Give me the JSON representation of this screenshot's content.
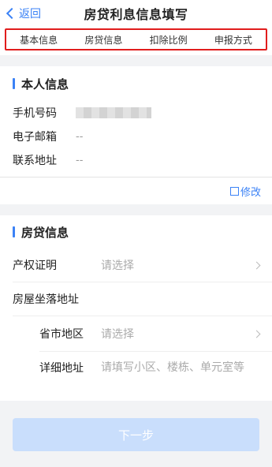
{
  "nav": {
    "back_label": "返回",
    "title": "房贷利息信息填写"
  },
  "tabs": [
    "基本信息",
    "房贷信息",
    "扣除比例",
    "申报方式"
  ],
  "personal": {
    "section_title": "本人信息",
    "phone_label": "手机号码",
    "email_label": "电子邮箱",
    "email_value": "--",
    "address_label": "联系地址",
    "address_value": "--",
    "edit_label": "修改"
  },
  "loan": {
    "section_title": "房贷信息",
    "cert_label": "产权证明",
    "cert_placeholder": "请选择",
    "house_address_label": "房屋坐落地址",
    "region_label": "省市地区",
    "region_placeholder": "请选择",
    "detail_label": "详细地址",
    "detail_placeholder": "请填写小区、楼栋、单元室等"
  },
  "footer": {
    "next_label": "下一步"
  },
  "colors": {
    "accent": "#3b82f6",
    "highlight_border": "#e11d1d",
    "button_disabled": "#c9defc"
  },
  "icons": [
    "chevron-left-icon",
    "edit-icon",
    "chevron-right-icon"
  ]
}
